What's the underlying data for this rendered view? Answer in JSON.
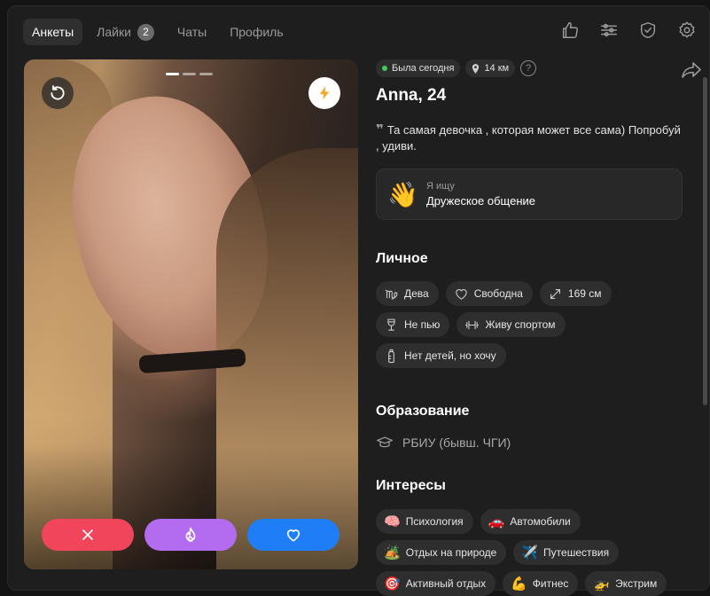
{
  "nav": {
    "tabs": [
      {
        "label": "Анкеты",
        "active": true
      },
      {
        "label": "Лайки",
        "badge": "2"
      },
      {
        "label": "Чаты"
      },
      {
        "label": "Профиль"
      }
    ],
    "icons": [
      "thumbs-up-icon",
      "sliders-icon",
      "shield-check-icon",
      "gear-icon"
    ]
  },
  "photo": {
    "slides": 3,
    "current_slide": 1,
    "buttons": [
      "undo-icon",
      "lightning-icon",
      "close-icon",
      "flame-icon",
      "heart-icon"
    ]
  },
  "profile": {
    "status": "Была сегодня",
    "distance": "14 км",
    "help_icon": "?",
    "name_age": "Anna, 24",
    "quote_mark": "❞",
    "bio": "Та самая девочка , которая может все сама) Попробуй , удиви.",
    "seeking": {
      "emoji": "👋",
      "label": "Я ищу",
      "value": "Дружеское общение"
    }
  },
  "personal": {
    "title": "Личное",
    "chips": [
      {
        "icon": "virgo-icon",
        "label": "Дева"
      },
      {
        "icon": "heart-outline-icon",
        "label": "Свободна"
      },
      {
        "icon": "height-arrows-icon",
        "label": "169 см"
      },
      {
        "icon": "wine-glass-icon",
        "label": "Не пью"
      },
      {
        "icon": "dumbbell-icon",
        "label": "Живу спортом"
      },
      {
        "icon": "baby-bottle-icon",
        "label": "Нет детей, но хочу"
      }
    ]
  },
  "education": {
    "title": "Образование",
    "value": "РБИУ (бывш. ЧГИ)"
  },
  "interests": {
    "title": "Интересы",
    "chips": [
      {
        "emoji": "🧠",
        "label": "Психология"
      },
      {
        "emoji": "🚗",
        "label": "Автомобили"
      },
      {
        "emoji": "🏕️",
        "label": "Отдых на природе"
      },
      {
        "emoji": "✈️",
        "label": "Путешествия"
      },
      {
        "emoji": "🎯",
        "label": "Активный отдых"
      },
      {
        "emoji": "💪",
        "label": "Фитнес"
      },
      {
        "emoji": "🚁",
        "label": "Экстрим"
      }
    ]
  },
  "colors": {
    "dislike": "#f0455a",
    "superlike": "#b36bf0",
    "like": "#1f7ef5",
    "online": "#3ecf5b"
  }
}
